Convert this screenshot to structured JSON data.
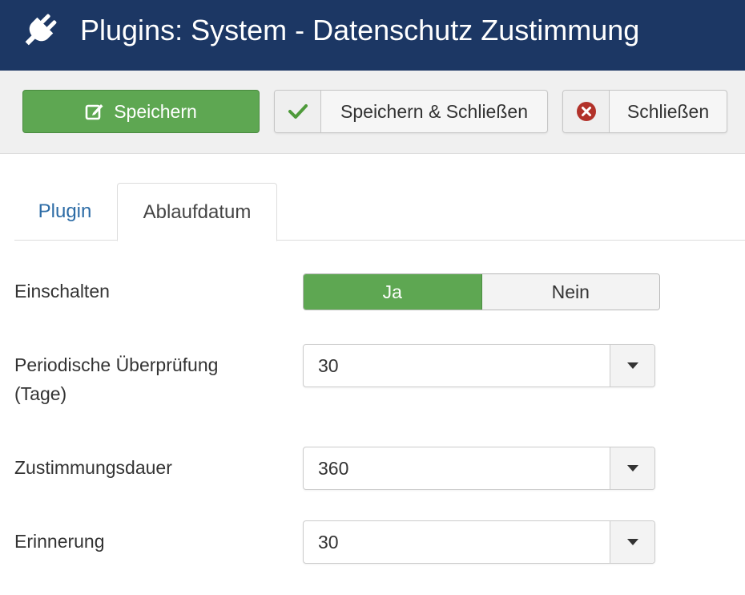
{
  "header": {
    "title": "Plugins: System - Datenschutz Zustimmung",
    "icon": "plug-icon"
  },
  "toolbar": {
    "save_label": "Speichern",
    "save_close_label": "Speichern & Schließen",
    "close_label": "Schließen",
    "save_color": "#5ea752",
    "check_color": "#4e9a3a",
    "close_icon_color": "#b2322a"
  },
  "tabs": [
    {
      "label": "Plugin",
      "active": false
    },
    {
      "label": "Ablaufdatum",
      "active": true
    }
  ],
  "fields": {
    "enable": {
      "label": "Einschalten",
      "yes": "Ja",
      "no": "Nein",
      "selected": "Ja"
    },
    "periodic": {
      "label": "Periodische Überprüfung (Tage)",
      "value": "30"
    },
    "duration": {
      "label": "Zustimmungsdauer",
      "value": "360"
    },
    "reminder": {
      "label": "Erinnerung",
      "value": "30"
    }
  },
  "colors": {
    "header_bg": "#1c3764",
    "link": "#2d6ca6"
  }
}
